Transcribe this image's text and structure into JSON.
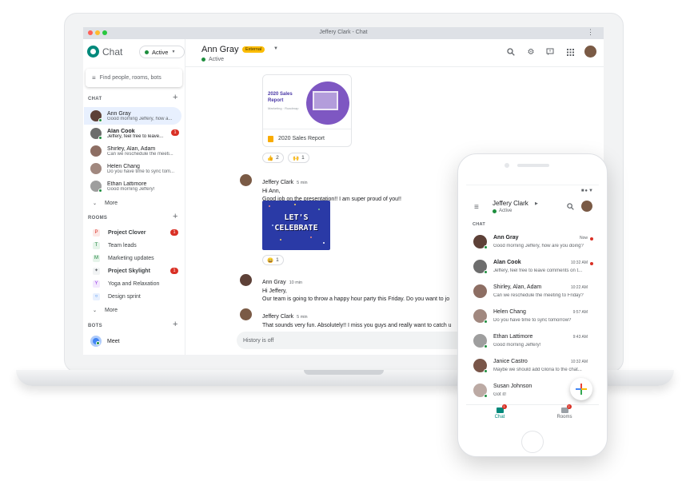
{
  "window": {
    "title": "Jeffery Clark - Chat"
  },
  "app": {
    "name": "Chat",
    "status": "Active"
  },
  "search": {
    "placeholder": "Find people, rooms, bots"
  },
  "sidebar": {
    "chat_header": "CHAT",
    "dms": [
      {
        "name": "Ann Gray",
        "preview": "Good morning Jeffery, how a...",
        "bold": false,
        "badge": "",
        "color": "#5d4037"
      },
      {
        "name": "Alan Cook",
        "preview": "Jeffery, feel free to leave...",
        "bold": true,
        "badge": "1",
        "color": "#6d6d6d"
      },
      {
        "name": "Shirley, Alan, Adam",
        "preview": "Can we reschedule the meeti...",
        "bold": false,
        "badge": "",
        "color": "#8d6e63"
      },
      {
        "name": "Helen Chang",
        "preview": "Do you have time to sync tom...",
        "bold": false,
        "badge": "",
        "color": "#a1887f"
      },
      {
        "name": "Ethan Lattimore",
        "preview": "Good morning Jeffery!",
        "bold": false,
        "badge": "",
        "color": "#9e9e9e"
      }
    ],
    "more_label": "More",
    "rooms_header": "ROOMS",
    "rooms": [
      {
        "letter": "P",
        "name": "Project Clover",
        "bold": true,
        "badge": "1",
        "bg": "#fce8e6",
        "fg": "#d93025"
      },
      {
        "letter": "T",
        "name": "Team leads",
        "bold": false,
        "badge": "",
        "bg": "#e6f4ea",
        "fg": "#188038"
      },
      {
        "letter": "M",
        "name": "Marketing updates",
        "bold": false,
        "badge": "",
        "bg": "#e6f4ea",
        "fg": "#188038"
      },
      {
        "letter": "",
        "name": "Project Skylight",
        "bold": true,
        "badge": "1",
        "bg": "#f1f3f4",
        "fg": "#5f6368"
      },
      {
        "letter": "Y",
        "name": "Yoga and Relaxation",
        "bold": false,
        "badge": "",
        "bg": "#f3e8fd",
        "fg": "#9334e6"
      },
      {
        "letter": "",
        "name": "Design sprint",
        "bold": false,
        "badge": "",
        "bg": "#e8f0fe",
        "fg": "#1a73e8"
      }
    ],
    "rooms_more_label": "More",
    "bots_header": "BOTS",
    "bots": [
      {
        "name": "Meet"
      }
    ]
  },
  "conversation": {
    "name": "Ann Gray",
    "external_badge": "External",
    "status": "Active",
    "attachment": {
      "thumb_title_line1": "2020 Sales",
      "thumb_title_line2": "Report",
      "thumb_subtitle": "Marketing · Roadmap",
      "file_name": "2020 Sales Report"
    },
    "reactions_1": [
      {
        "emoji": "👍",
        "count": "2"
      },
      {
        "emoji": "🙌",
        "count": "1"
      }
    ],
    "messages": [
      {
        "sender": "Jeffery Clark",
        "time": "5 min",
        "lines": [
          "Hi Ann,",
          "Good job on the presentation!! I am super proud of you!!"
        ]
      },
      {
        "sender": "Ann Gray",
        "time": "10 min",
        "lines": [
          "Hi Jeffery,",
          "Our team is going to throw a happy hour party this Friday. Do you want to jo"
        ]
      },
      {
        "sender": "Jeffery Clark",
        "time": "5 min",
        "lines": [
          "That sounds very fun. Absolutely!! I miss you guys and really want to catch u"
        ]
      }
    ],
    "gif_text_line1": "LET'S",
    "gif_text_line2": "CELEBRATE",
    "reactions_2": [
      {
        "emoji": "😄",
        "count": "1"
      }
    ],
    "compose_placeholder": "History is off"
  },
  "phone": {
    "user_name": "Jeffery Clark",
    "user_status": "Active",
    "chat_header": "CHAT",
    "items": [
      {
        "name": "Ann Gray",
        "preview": "Good morning Jeffery, how are you doing?",
        "time": "Now",
        "bold": true,
        "unread": true,
        "color": "#5d4037"
      },
      {
        "name": "Alan Cook",
        "preview": "Jeffery, feel free to leave comments on t...",
        "time": "10:32 AM",
        "bold": true,
        "unread": true,
        "color": "#6d6d6d"
      },
      {
        "name": "Shirley, Alan, Adam",
        "preview": "Can we reschedule the meeting to Friday?",
        "time": "10:22 AM",
        "bold": false,
        "unread": false,
        "color": "#8d6e63"
      },
      {
        "name": "Helen Chang",
        "preview": "Do you have time to sync tomorrow?",
        "time": "9:57 AM",
        "bold": false,
        "unread": false,
        "color": "#a1887f"
      },
      {
        "name": "Ethan Lattimore",
        "preview": "Good morning Jeffery!",
        "time": "9:43 AM",
        "bold": false,
        "unread": false,
        "color": "#9e9e9e"
      },
      {
        "name": "Janice Castro",
        "preview": "Maybe we should add Gloria to the chat...",
        "time": "10:32 AM",
        "bold": false,
        "unread": false,
        "color": "#795548"
      },
      {
        "name": "Susan Johnson",
        "preview": "Got it!",
        "time": "",
        "bold": false,
        "unread": false,
        "color": "#bcaaa4"
      }
    ],
    "nav": [
      {
        "label": "Chat",
        "badge": "1",
        "active": true
      },
      {
        "label": "Rooms",
        "badge": "2",
        "active": false
      }
    ]
  },
  "colors": {
    "accent": "#1a73e8",
    "active_green": "#1e8e3e",
    "badge_red": "#d93025",
    "chat_teal": "#00897b"
  }
}
